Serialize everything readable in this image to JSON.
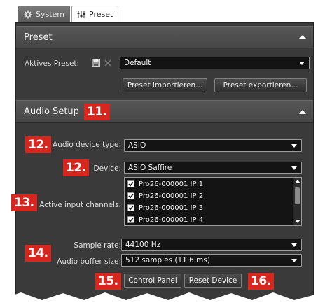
{
  "tabs": [
    {
      "label": "System",
      "icon": "gear-icon",
      "active": false
    },
    {
      "label": "Preset",
      "icon": "sliders-icon",
      "active": true
    }
  ],
  "preset_section": {
    "title": "Preset",
    "active_preset_label": "Aktives Preset:",
    "active_preset_value": "Default",
    "import_button": "Preset importieren...",
    "export_button": "Preset exportieren..."
  },
  "audio_setup": {
    "title": "Audio Setup",
    "device_type_label": "Audio device type:",
    "device_type_value": "ASIO",
    "device_label": "Device:",
    "device_value": "ASIO Saffire",
    "input_channels_label": "Active input channels:",
    "input_channels": [
      {
        "name": "Pro26-000001 IP 1",
        "checked": true
      },
      {
        "name": "Pro26-000001 IP 2",
        "checked": true
      },
      {
        "name": "Pro26-000001 IP 3",
        "checked": true
      },
      {
        "name": "Pro26-000001 IP 4",
        "checked": true
      }
    ],
    "sample_rate_label": "Sample rate:",
    "sample_rate_value": "44100 Hz",
    "buffer_size_label": "Audio buffer size:",
    "buffer_size_value": "512 samples (11.6 ms)",
    "control_panel_button": "Control Panel",
    "reset_device_button": "Reset Device"
  },
  "markers": [
    "11.",
    "12.",
    "12.",
    "13.",
    "14.",
    "15.",
    "16."
  ],
  "colors": {
    "panel_bg": "#3a3a3a",
    "header_bg": "#4f4f4f",
    "field_bg": "#141414",
    "marker_red": "#d7261e"
  }
}
